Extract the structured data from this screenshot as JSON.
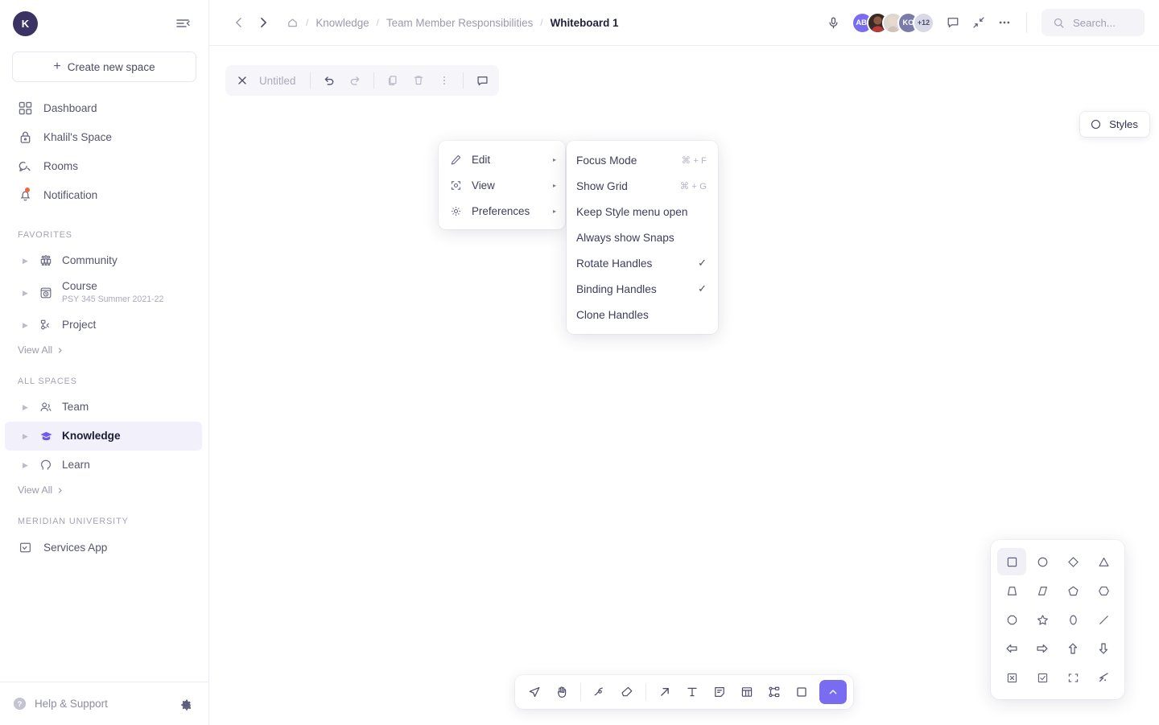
{
  "sidebar": {
    "user_initial": "K",
    "collapse_icon": "collapse-sidebar-icon",
    "create_button": "Create new space",
    "nav": [
      {
        "label": "Dashboard",
        "icon": "grid-icon"
      },
      {
        "label": "Khalil's Space",
        "icon": "lock-icon"
      },
      {
        "label": "Rooms",
        "icon": "chat-bubbles-icon"
      },
      {
        "label": "Notification",
        "icon": "bell-icon",
        "badge": true
      }
    ],
    "favorites_label": "FAVORITES",
    "favorites": [
      {
        "label": "Community",
        "sub": "",
        "icon": "people-group-icon"
      },
      {
        "label": "Course",
        "sub": "PSY 345 Summer 2021-22",
        "icon": "clock-box-icon"
      },
      {
        "label": "Project",
        "sub": "",
        "icon": "sitemap-icon"
      }
    ],
    "favorites_view_all": "View All",
    "all_spaces_label": "ALL SPACES",
    "all_spaces": [
      {
        "label": "Team",
        "icon": "users-icon",
        "active": false
      },
      {
        "label": "Knowledge",
        "icon": "graduation-cap-icon",
        "active": true
      },
      {
        "label": "Learn",
        "icon": "head-profile-icon",
        "active": false
      }
    ],
    "all_spaces_view_all": "View All",
    "org_label": "MERIDIAN UNIVERSITY",
    "org_items": [
      {
        "label": "Services App",
        "icon": "app-box-icon"
      }
    ],
    "help_label": "Help & Support",
    "settings_icon": "gear-icon"
  },
  "header": {
    "back_icon": "chevron-left-icon",
    "forward_icon": "chevron-right-icon",
    "home_icon": "home-icon",
    "breadcrumbs": [
      "Knowledge",
      "Team Member Responsibilities"
    ],
    "current_page": "Whiteboard 1",
    "separator": "/",
    "mic_icon": "microphone-icon",
    "avatars": [
      {
        "initials": "ABI",
        "color": "#7a6cf0",
        "type": "initials"
      },
      {
        "initials": "",
        "color": "#6e4a3c",
        "type": "photo"
      },
      {
        "initials": "",
        "color": "#cfc8c2",
        "type": "photo"
      },
      {
        "initials": "KO",
        "color": "#7b7baa",
        "type": "initials"
      }
    ],
    "avatar_overflow": "+12",
    "comment_icon": "comment-icon",
    "collapse_icon": "collapse-arrows-icon",
    "more_icon": "more-horizontal-icon",
    "search_placeholder": "Search...",
    "search_icon": "search-icon"
  },
  "whiteboard_toolbar": {
    "close_icon": "close-icon",
    "title": "Untitled",
    "undo_icon": "undo-icon",
    "redo_icon": "redo-icon",
    "copy_icon": "copy-icon",
    "delete_icon": "trash-icon",
    "more_icon": "more-vertical-icon",
    "comment_icon": "comment-icon"
  },
  "context_menu": {
    "items": [
      {
        "label": "Edit",
        "icon": "pencil-icon",
        "arrow": "▸"
      },
      {
        "label": "View",
        "icon": "viewfinder-icon",
        "arrow": "▸"
      },
      {
        "label": "Preferences",
        "icon": "gear-icon",
        "arrow": "▸"
      }
    ]
  },
  "preferences_submenu": {
    "items": [
      {
        "label": "Focus Mode",
        "shortcut": "⌘ + F",
        "checked": false
      },
      {
        "label": "Show Grid",
        "shortcut": "⌘ + G",
        "checked": false
      },
      {
        "label": "Keep Style menu open",
        "shortcut": "",
        "checked": false
      },
      {
        "label": "Always show Snaps",
        "shortcut": "",
        "checked": false
      },
      {
        "label": "Rotate Handles",
        "shortcut": "",
        "checked": true
      },
      {
        "label": "Binding Handles",
        "shortcut": "",
        "checked": true
      },
      {
        "label": "Clone Handles",
        "shortcut": "",
        "checked": false
      }
    ],
    "check_glyph": "✓"
  },
  "styles_button": {
    "label": "Styles",
    "icon": "circle-outline-icon"
  },
  "shapes_panel": {
    "shapes": [
      {
        "name": "square-shape",
        "selected": true
      },
      {
        "name": "circle-shape",
        "selected": false
      },
      {
        "name": "diamond-shape",
        "selected": false
      },
      {
        "name": "triangle-shape",
        "selected": false
      },
      {
        "name": "trapezoid-shape",
        "selected": false
      },
      {
        "name": "rhombus-shape",
        "selected": false
      },
      {
        "name": "pentagon-shape",
        "selected": false
      },
      {
        "name": "hexagon-shape",
        "selected": false
      },
      {
        "name": "octagon-shape",
        "selected": false
      },
      {
        "name": "star-shape",
        "selected": false
      },
      {
        "name": "oval-shape",
        "selected": false
      },
      {
        "name": "line-shape",
        "selected": false
      },
      {
        "name": "arrow-left-shape",
        "selected": false
      },
      {
        "name": "arrow-right-shape",
        "selected": false
      },
      {
        "name": "arrow-up-shape",
        "selected": false
      },
      {
        "name": "arrow-down-shape",
        "selected": false
      },
      {
        "name": "x-box-shape",
        "selected": false
      },
      {
        "name": "check-box-shape",
        "selected": false
      },
      {
        "name": "dashed-frame-shape",
        "selected": false
      },
      {
        "name": "lightning-shape",
        "selected": false
      }
    ]
  },
  "bottom_toolbar": {
    "tools": [
      {
        "name": "select-tool",
        "active": false
      },
      {
        "name": "hand-tool",
        "active": false
      },
      {
        "name": "draw-tool",
        "active": false
      },
      {
        "name": "eraser-tool",
        "active": false
      },
      {
        "name": "arrow-tool",
        "active": false
      },
      {
        "name": "text-tool",
        "active": false
      },
      {
        "name": "note-tool",
        "active": false
      },
      {
        "name": "table-tool",
        "active": false
      },
      {
        "name": "mindmap-tool",
        "active": false
      },
      {
        "name": "shape-tool",
        "active": false
      }
    ],
    "expand_button": {
      "name": "expand-shapes-button",
      "glyph": "⌃",
      "color": "#7a6cf0"
    }
  }
}
